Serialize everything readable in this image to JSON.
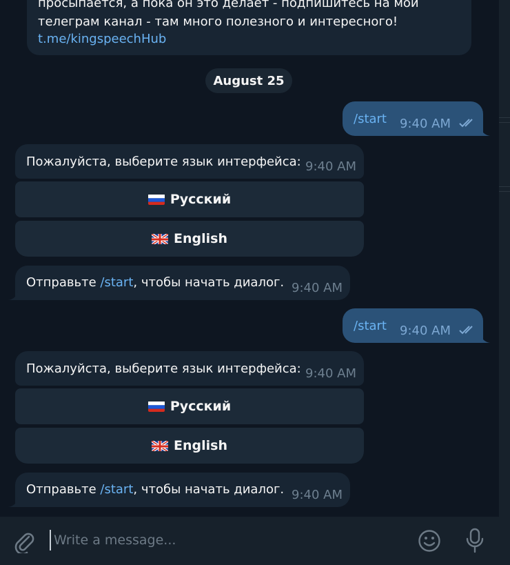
{
  "top_message": {
    "line1": "просыпается, а пока он это делает - подпишитесь на мой",
    "line2": "телеграм канал - там много полезного и интересного!",
    "link": "t.me/kingspeechHub"
  },
  "date_separator": "August 25",
  "messages": [
    {
      "type": "out",
      "text": "/start",
      "time": "9:40 AM",
      "status": "read"
    },
    {
      "type": "in",
      "text": "Пожалуйста, выберите язык интерфейса:",
      "time": "9:40 AM",
      "buttons": [
        {
          "flag": "flag-russia-icon",
          "label": "Русский"
        },
        {
          "flag": "flag-uk-icon",
          "label": "English"
        }
      ]
    },
    {
      "type": "in",
      "text_before": "Отправьте ",
      "command": "/start",
      "text_after": ", чтобы начать диалог.",
      "time": "9:40 AM"
    },
    {
      "type": "out",
      "text": "/start",
      "time": "9:40 AM",
      "status": "read"
    },
    {
      "type": "in",
      "text": "Пожалуйста, выберите язык интерфейса:",
      "time": "9:40 AM",
      "buttons": [
        {
          "flag": "flag-russia-icon",
          "label": "Русский"
        },
        {
          "flag": "flag-uk-icon",
          "label": "English"
        }
      ]
    },
    {
      "type": "in",
      "text_before": "Отправьте ",
      "command": "/start",
      "text_after": ", чтобы начать диалог.",
      "time": "9:40 AM"
    }
  ],
  "composer": {
    "placeholder": "Write a message...",
    "attach_icon": "paperclip-icon",
    "emoji_icon": "emoji-icon",
    "mic_icon": "microphone-icon"
  },
  "colors": {
    "background": "#0e1621",
    "incoming_bubble": "#182533",
    "outgoing_bubble": "#2b5278",
    "link": "#6ab3f3"
  }
}
